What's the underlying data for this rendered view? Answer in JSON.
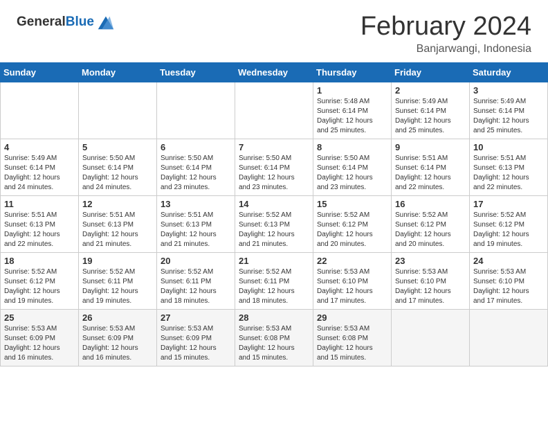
{
  "logo": {
    "general": "General",
    "blue": "Blue"
  },
  "header": {
    "month": "February 2024",
    "location": "Banjarwangi, Indonesia"
  },
  "weekdays": [
    "Sunday",
    "Monday",
    "Tuesday",
    "Wednesday",
    "Thursday",
    "Friday",
    "Saturday"
  ],
  "weeks": [
    [
      {
        "day": "",
        "info": ""
      },
      {
        "day": "",
        "info": ""
      },
      {
        "day": "",
        "info": ""
      },
      {
        "day": "",
        "info": ""
      },
      {
        "day": "1",
        "info": "Sunrise: 5:48 AM\nSunset: 6:14 PM\nDaylight: 12 hours\nand 25 minutes."
      },
      {
        "day": "2",
        "info": "Sunrise: 5:49 AM\nSunset: 6:14 PM\nDaylight: 12 hours\nand 25 minutes."
      },
      {
        "day": "3",
        "info": "Sunrise: 5:49 AM\nSunset: 6:14 PM\nDaylight: 12 hours\nand 25 minutes."
      }
    ],
    [
      {
        "day": "4",
        "info": "Sunrise: 5:49 AM\nSunset: 6:14 PM\nDaylight: 12 hours\nand 24 minutes."
      },
      {
        "day": "5",
        "info": "Sunrise: 5:50 AM\nSunset: 6:14 PM\nDaylight: 12 hours\nand 24 minutes."
      },
      {
        "day": "6",
        "info": "Sunrise: 5:50 AM\nSunset: 6:14 PM\nDaylight: 12 hours\nand 23 minutes."
      },
      {
        "day": "7",
        "info": "Sunrise: 5:50 AM\nSunset: 6:14 PM\nDaylight: 12 hours\nand 23 minutes."
      },
      {
        "day": "8",
        "info": "Sunrise: 5:50 AM\nSunset: 6:14 PM\nDaylight: 12 hours\nand 23 minutes."
      },
      {
        "day": "9",
        "info": "Sunrise: 5:51 AM\nSunset: 6:14 PM\nDaylight: 12 hours\nand 22 minutes."
      },
      {
        "day": "10",
        "info": "Sunrise: 5:51 AM\nSunset: 6:13 PM\nDaylight: 12 hours\nand 22 minutes."
      }
    ],
    [
      {
        "day": "11",
        "info": "Sunrise: 5:51 AM\nSunset: 6:13 PM\nDaylight: 12 hours\nand 22 minutes."
      },
      {
        "day": "12",
        "info": "Sunrise: 5:51 AM\nSunset: 6:13 PM\nDaylight: 12 hours\nand 21 minutes."
      },
      {
        "day": "13",
        "info": "Sunrise: 5:51 AM\nSunset: 6:13 PM\nDaylight: 12 hours\nand 21 minutes."
      },
      {
        "day": "14",
        "info": "Sunrise: 5:52 AM\nSunset: 6:13 PM\nDaylight: 12 hours\nand 21 minutes."
      },
      {
        "day": "15",
        "info": "Sunrise: 5:52 AM\nSunset: 6:12 PM\nDaylight: 12 hours\nand 20 minutes."
      },
      {
        "day": "16",
        "info": "Sunrise: 5:52 AM\nSunset: 6:12 PM\nDaylight: 12 hours\nand 20 minutes."
      },
      {
        "day": "17",
        "info": "Sunrise: 5:52 AM\nSunset: 6:12 PM\nDaylight: 12 hours\nand 19 minutes."
      }
    ],
    [
      {
        "day": "18",
        "info": "Sunrise: 5:52 AM\nSunset: 6:12 PM\nDaylight: 12 hours\nand 19 minutes."
      },
      {
        "day": "19",
        "info": "Sunrise: 5:52 AM\nSunset: 6:11 PM\nDaylight: 12 hours\nand 19 minutes."
      },
      {
        "day": "20",
        "info": "Sunrise: 5:52 AM\nSunset: 6:11 PM\nDaylight: 12 hours\nand 18 minutes."
      },
      {
        "day": "21",
        "info": "Sunrise: 5:52 AM\nSunset: 6:11 PM\nDaylight: 12 hours\nand 18 minutes."
      },
      {
        "day": "22",
        "info": "Sunrise: 5:53 AM\nSunset: 6:10 PM\nDaylight: 12 hours\nand 17 minutes."
      },
      {
        "day": "23",
        "info": "Sunrise: 5:53 AM\nSunset: 6:10 PM\nDaylight: 12 hours\nand 17 minutes."
      },
      {
        "day": "24",
        "info": "Sunrise: 5:53 AM\nSunset: 6:10 PM\nDaylight: 12 hours\nand 17 minutes."
      }
    ],
    [
      {
        "day": "25",
        "info": "Sunrise: 5:53 AM\nSunset: 6:09 PM\nDaylight: 12 hours\nand 16 minutes."
      },
      {
        "day": "26",
        "info": "Sunrise: 5:53 AM\nSunset: 6:09 PM\nDaylight: 12 hours\nand 16 minutes."
      },
      {
        "day": "27",
        "info": "Sunrise: 5:53 AM\nSunset: 6:09 PM\nDaylight: 12 hours\nand 15 minutes."
      },
      {
        "day": "28",
        "info": "Sunrise: 5:53 AM\nSunset: 6:08 PM\nDaylight: 12 hours\nand 15 minutes."
      },
      {
        "day": "29",
        "info": "Sunrise: 5:53 AM\nSunset: 6:08 PM\nDaylight: 12 hours\nand 15 minutes."
      },
      {
        "day": "",
        "info": ""
      },
      {
        "day": "",
        "info": ""
      }
    ]
  ]
}
